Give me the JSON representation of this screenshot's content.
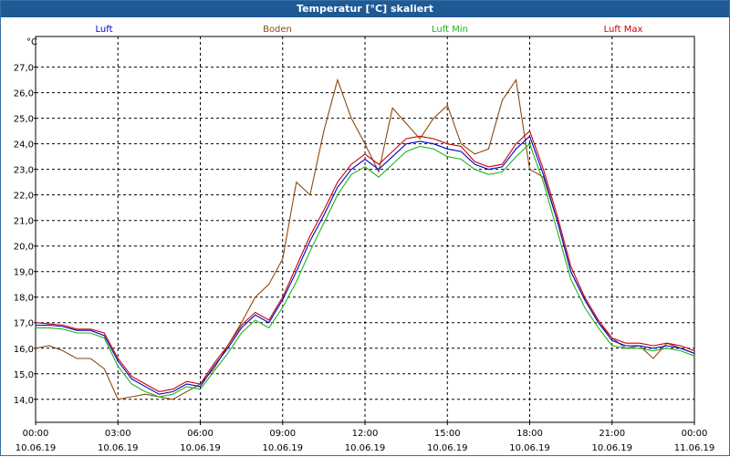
{
  "window": {
    "title": "Temperatur [°C] skaliert"
  },
  "chart_data": {
    "type": "line",
    "ylabel": "°C",
    "ylim": [
      13.1,
      28.2
    ],
    "yticks": [
      14.0,
      15.0,
      16.0,
      17.0,
      18.0,
      19.0,
      20.0,
      21.0,
      22.0,
      23.0,
      24.0,
      25.0,
      26.0,
      27.0
    ],
    "ytick_labels": [
      "14,0",
      "15,0",
      "16,0",
      "17,0",
      "18,0",
      "19,0",
      "20,0",
      "21,0",
      "22,0",
      "23,0",
      "24,0",
      "25,0",
      "26,0",
      "27,0"
    ],
    "xlim_hours": [
      0,
      24
    ],
    "xticks": [
      {
        "time": "00:00",
        "date": "10.06.19"
      },
      {
        "time": "03:00",
        "date": "10.06.19"
      },
      {
        "time": "06:00",
        "date": "10.06.19"
      },
      {
        "time": "09:00",
        "date": "10.06.19"
      },
      {
        "time": "12:00",
        "date": "10.06.19"
      },
      {
        "time": "15:00",
        "date": "10.06.19"
      },
      {
        "time": "18:00",
        "date": "10.06.19"
      },
      {
        "time": "21:00",
        "date": "10.06.19"
      },
      {
        "time": "00:00",
        "date": "11.06.19"
      }
    ],
    "grid": true,
    "legend_position": "top",
    "series": [
      {
        "name": "Luft",
        "color": "#0000cc",
        "x": [
          0,
          0.5,
          1,
          1.5,
          2,
          2.5,
          3,
          3.5,
          4,
          4.5,
          5,
          5.5,
          6,
          6.5,
          7,
          7.5,
          8,
          8.5,
          9,
          9.5,
          10,
          10.5,
          11,
          11.5,
          12,
          12.5,
          13,
          13.5,
          14,
          14.5,
          15,
          15.5,
          16,
          16.5,
          17,
          17.5,
          18,
          18.5,
          19,
          19.5,
          20,
          20.5,
          21,
          21.5,
          22,
          22.5,
          23,
          23.5,
          24
        ],
        "y": [
          16.9,
          16.9,
          16.85,
          16.7,
          16.7,
          16.5,
          15.5,
          14.8,
          14.5,
          14.2,
          14.3,
          14.6,
          14.5,
          15.3,
          16.0,
          16.8,
          17.3,
          17.0,
          17.9,
          19.0,
          20.2,
          21.2,
          22.3,
          23.0,
          23.4,
          23.0,
          23.5,
          24.0,
          24.1,
          24.0,
          23.8,
          23.7,
          23.2,
          23.0,
          23.1,
          23.8,
          24.3,
          22.8,
          21.0,
          19.0,
          17.9,
          17.0,
          16.3,
          16.1,
          16.1,
          16.0,
          16.1,
          16.0,
          15.8
        ]
      },
      {
        "name": "Boden",
        "color": "#8b4a10",
        "x": [
          0,
          0.5,
          1,
          1.5,
          2,
          2.5,
          3,
          3.5,
          4,
          4.5,
          5,
          5.5,
          6,
          6.5,
          7,
          7.5,
          8,
          8.5,
          9,
          9.5,
          10,
          10.5,
          11,
          11.5,
          12,
          12.5,
          13,
          13.5,
          14,
          14.5,
          15,
          15.5,
          16,
          16.5,
          17,
          17.5,
          18,
          18.5,
          19,
          19.5,
          20,
          20.5,
          21,
          21.5,
          22,
          22.5,
          23,
          23.5,
          24
        ],
        "y": [
          16.0,
          16.1,
          15.9,
          15.6,
          15.6,
          15.2,
          14.0,
          14.1,
          14.2,
          14.1,
          14.0,
          14.3,
          14.6,
          15.2,
          16.1,
          17.0,
          18.0,
          18.5,
          19.5,
          22.5,
          22.0,
          24.5,
          26.5,
          25.0,
          24.0,
          22.9,
          25.4,
          24.8,
          24.2,
          25.0,
          25.5,
          24.0,
          23.6,
          23.8,
          25.7,
          26.5,
          23.0,
          22.7,
          21.0,
          19.0,
          17.9,
          17.0,
          16.4,
          16.0,
          16.1,
          15.6,
          16.2,
          16.0,
          15.8
        ]
      },
      {
        "name": "Luft Min",
        "color": "#1eb41e",
        "x": [
          0,
          0.5,
          1,
          1.5,
          2,
          2.5,
          3,
          3.5,
          4,
          4.5,
          5,
          5.5,
          6,
          6.5,
          7,
          7.5,
          8,
          8.5,
          9,
          9.5,
          10,
          10.5,
          11,
          11.5,
          12,
          12.5,
          13,
          13.5,
          14,
          14.5,
          15,
          15.5,
          16,
          16.5,
          17,
          17.5,
          18,
          18.5,
          19,
          19.5,
          20,
          20.5,
          21,
          21.5,
          22,
          22.5,
          23,
          23.5,
          24
        ],
        "y": [
          16.8,
          16.8,
          16.75,
          16.6,
          16.6,
          16.4,
          15.3,
          14.6,
          14.3,
          14.1,
          14.2,
          14.5,
          14.4,
          15.1,
          15.8,
          16.6,
          17.1,
          16.8,
          17.6,
          18.6,
          19.8,
          20.9,
          22.0,
          22.8,
          23.1,
          22.7,
          23.2,
          23.7,
          23.9,
          23.8,
          23.5,
          23.4,
          23.0,
          22.8,
          22.9,
          23.5,
          24.0,
          22.5,
          20.6,
          18.7,
          17.6,
          16.8,
          16.1,
          16.0,
          16.0,
          15.9,
          16.0,
          15.9,
          15.7
        ]
      },
      {
        "name": "Luft Max",
        "color": "#cc0000",
        "x": [
          0,
          0.5,
          1,
          1.5,
          2,
          2.5,
          3,
          3.5,
          4,
          4.5,
          5,
          5.5,
          6,
          6.5,
          7,
          7.5,
          8,
          8.5,
          9,
          9.5,
          10,
          10.5,
          11,
          11.5,
          12,
          12.5,
          13,
          13.5,
          14,
          14.5,
          15,
          15.5,
          16,
          16.5,
          17,
          17.5,
          18,
          18.5,
          19,
          19.5,
          20,
          20.5,
          21,
          21.5,
          22,
          22.5,
          23,
          23.5,
          24
        ],
        "y": [
          17.0,
          16.95,
          16.9,
          16.75,
          16.75,
          16.6,
          15.6,
          14.9,
          14.6,
          14.3,
          14.4,
          14.7,
          14.6,
          15.4,
          16.1,
          16.9,
          17.4,
          17.1,
          18.0,
          19.2,
          20.4,
          21.4,
          22.5,
          23.2,
          23.6,
          23.2,
          23.7,
          24.2,
          24.3,
          24.2,
          24.0,
          23.9,
          23.3,
          23.1,
          23.2,
          24.0,
          24.5,
          23.0,
          21.2,
          19.2,
          18.0,
          17.1,
          16.4,
          16.2,
          16.2,
          16.1,
          16.2,
          16.1,
          15.9
        ]
      }
    ]
  }
}
